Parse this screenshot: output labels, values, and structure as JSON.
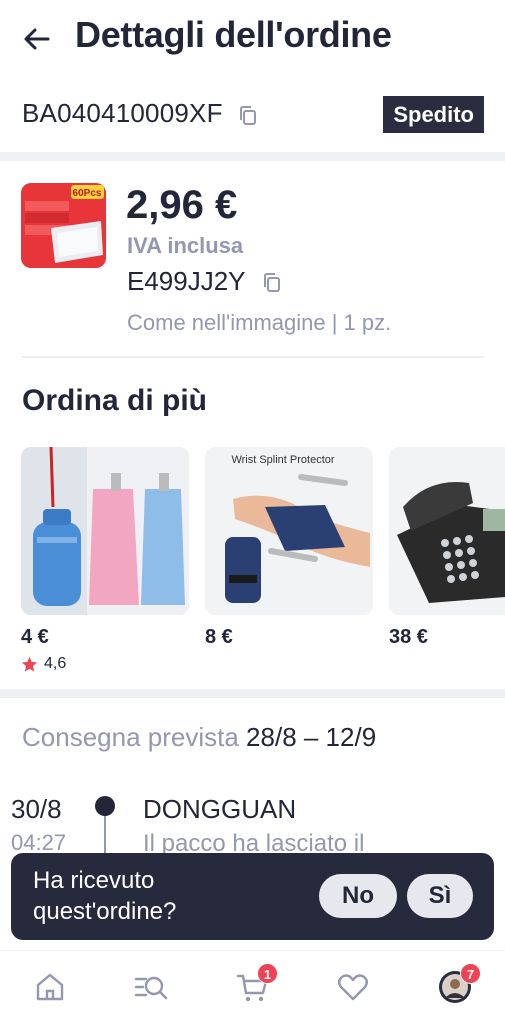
{
  "header": {
    "title": "Dettagli dell'ordine",
    "back_icon": "arrow-left-icon"
  },
  "order": {
    "id": "BA040410009XF",
    "status": "Spedito"
  },
  "item": {
    "price": "2,96 €",
    "vat_note": "IVA inclusa",
    "code": "E499JJ2Y",
    "variant": "Come nell'immagine | 1 pz.",
    "thumb_badge": "60Pcs"
  },
  "order_more": {
    "title": "Ordina di più",
    "products": [
      {
        "price": "4 €",
        "rating": "4,6"
      },
      {
        "price": "8 €",
        "image_caption": "Wrist Splint Protector"
      },
      {
        "price": "38 €"
      }
    ]
  },
  "delivery": {
    "label": "Consegna prevista",
    "range": "28/8 – 12/9"
  },
  "tracking": {
    "date": "30/8",
    "time": "04:27",
    "city": "DONGGUAN",
    "message": "Il pacco ha lasciato il"
  },
  "prompt": {
    "question": "Ha ricevuto quest'ordine?",
    "no": "No",
    "yes": "Sì"
  },
  "nav": {
    "items": [
      "home-icon",
      "search-list-icon",
      "cart-icon",
      "heart-icon",
      "avatar"
    ],
    "cart_badge": "1",
    "profile_badge": "7"
  },
  "colors": {
    "accent": "#222638",
    "muted": "#9397b0",
    "badge": "#ee4354",
    "star": "#ee4354"
  }
}
